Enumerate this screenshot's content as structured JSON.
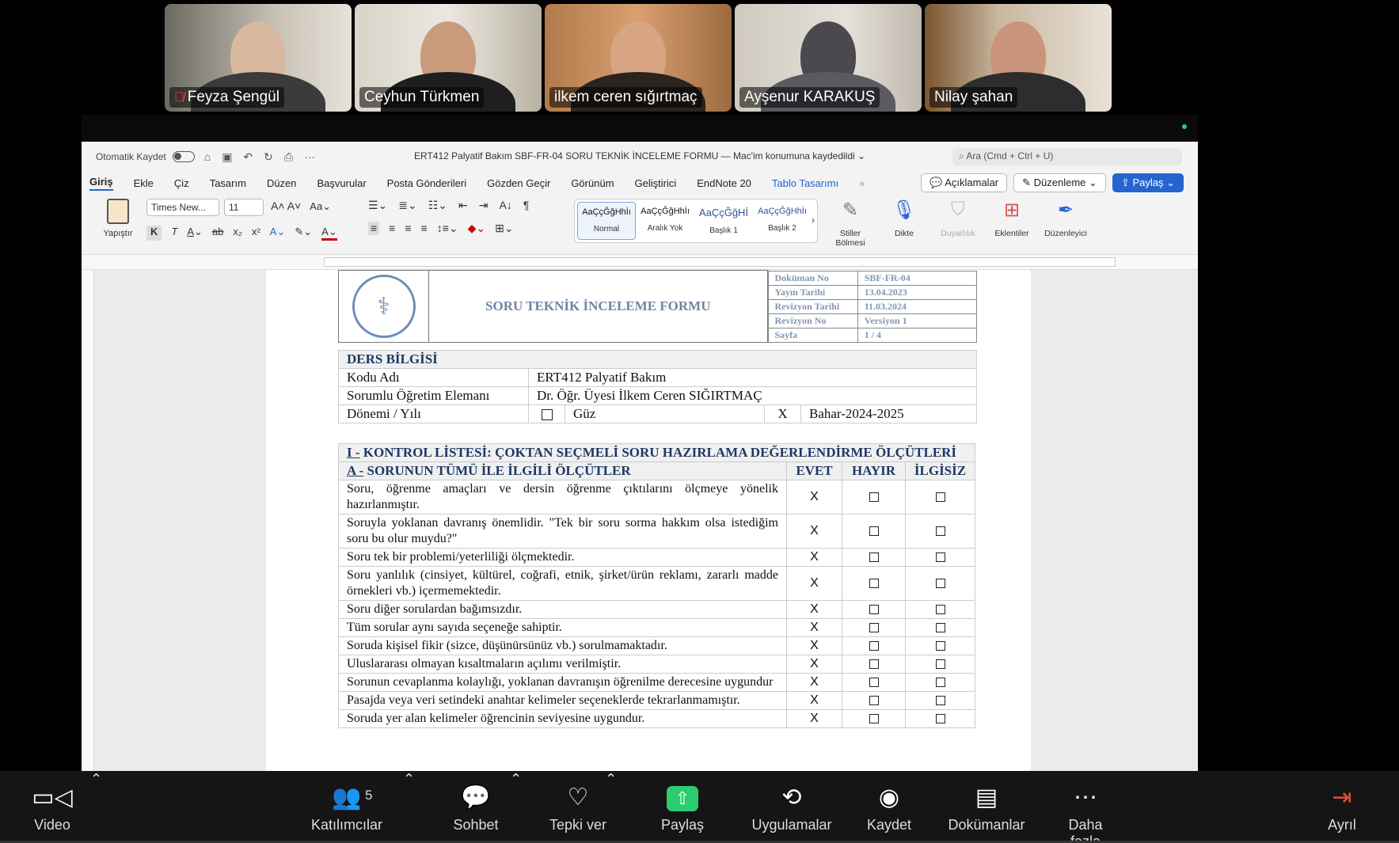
{
  "participants": [
    {
      "name": "Feyza Şengül",
      "muted": true,
      "color": "#7a6a5c"
    },
    {
      "name": "Ceyhun Türkmen",
      "muted": false,
      "active": true,
      "color": "#a7a08f"
    },
    {
      "name": "ilkem ceren sığırtmaç",
      "muted": false,
      "color": "#8a5a33"
    },
    {
      "name": "Ayşenur KARAKUŞ",
      "muted": false,
      "color": "#9a938c"
    },
    {
      "name": "Nilay şahan",
      "muted": false,
      "color": "#8e6b4a"
    }
  ],
  "word": {
    "autosave_label": "Otomatik Kaydet",
    "doc_title": "ERT412 Palyatif Bakım SBF-FR-04 SORU TEKNİK İNCELEME FORMU — Mac'im konumuna kaydedildi ⌄",
    "search_placeholder": "Ara (Cmd + Ctrl + U)",
    "tabs": [
      "Giriş",
      "Ekle",
      "Çiz",
      "Tasarım",
      "Düzen",
      "Başvurular",
      "Posta Gönderileri",
      "Gözden Geçir",
      "Görünüm",
      "Geliştirici",
      "EndNote 20",
      "Tablo Tasarımı"
    ],
    "comments_btn": "Açıklamalar",
    "editing_btn": "Düzenleme",
    "share_btn": "Paylaş",
    "paste_label": "Yapıştır",
    "font_name": "Times New...",
    "font_size": "11",
    "styles": [
      {
        "sample": "AaÇçĞğHhİı",
        "label": "Normal"
      },
      {
        "sample": "AaÇçĞğHhİı",
        "label": "Aralık Yok"
      },
      {
        "sample": "AaÇçĞğHİ",
        "label": "Başlık 1"
      },
      {
        "sample": "AaÇçĞğHhİı",
        "label": "Başlık 2"
      }
    ],
    "big_buttons": {
      "styles_pane": "Stiller Bölmesi",
      "dictate": "Dikte",
      "sensitivity": "Duyarlılık",
      "addins": "Eklentiler",
      "editor": "Düzenleyici"
    }
  },
  "form": {
    "title": "SORU TEKNİK İNCELEME FORMU",
    "meta": [
      {
        "label": "Doküman No",
        "value": "SBF-FR-04"
      },
      {
        "label": "Yayın Tarihi",
        "value": "13.04.2023"
      },
      {
        "label": "Revizyon Tarihi",
        "value": "11.03.2024"
      },
      {
        "label": "Revizyon No",
        "value": "Versiyon 1"
      },
      {
        "label": "Sayfa",
        "value": "1 / 4"
      }
    ],
    "course": {
      "heading": "DERS BİLGİSİ",
      "code_label": "Kodu Adı",
      "code_value": "ERT412 Palyatif Bakım",
      "instructor_label": "Sorumlu Öğretim Elemanı",
      "instructor_value": "Dr. Öğr. Üyesi İlkem Ceren SIĞIRTMAÇ",
      "term_label": "Dönemi / Yılı",
      "fall_label": "Güz",
      "spring_mark": "X",
      "spring_label": "Bahar-2024-2025"
    },
    "checklist": {
      "section_prefix": "I -",
      "section_title": "KONTROL LİSTESİ: ÇOKTAN SEÇMELİ SORU HAZIRLAMA DEĞERLENDİRME ÖLÇÜTLERİ",
      "sub_prefix": "A -",
      "sub_title": "SORUNUN TÜMÜ İLE İLGİLİ ÖLÇÜTLER",
      "col_yes": "EVET",
      "col_no": "HAYIR",
      "col_na": "İLGİSİZ",
      "mark": "X",
      "items": [
        "Soru, öğrenme amaçları ve dersin öğrenme çıktılarını ölçmeye yönelik hazırlanmıştır.",
        "Soruyla yoklanan davranış önemlidir. \"Tek bir soru sorma hakkım olsa istediğim soru bu olur muydu?\"",
        "Soru tek bir problemi/yeterliliği ölçmektedir.",
        "Soru yanlılık (cinsiyet, kültürel, coğrafi, etnik, şirket/ürün reklamı, zararlı madde örnekleri vb.) içermemektedir.",
        "Soru diğer sorulardan bağımsızdır.",
        "Tüm sorular aynı sayıda seçeneğe sahiptir.",
        "Soruda kişisel fikir (sizce, düşünürsünüz vb.) sorulmamaktadır.",
        "Uluslararası olmayan kısaltmaların açılımı verilmiştir.",
        "Sorunun cevaplanma kolaylığı, yoklanan davranışın öğrenilme derecesine uygundur",
        "Pasajda veya veri setindeki anahtar kelimeler seçeneklerde tekrarlanmamıştır.",
        "Soruda yer alan kelimeler öğrencinin seviyesine uygundur."
      ]
    }
  },
  "toolbar": {
    "video": "Video",
    "participants": "Katılımcılar",
    "participant_count": "5",
    "chat": "Sohbet",
    "react": "Tepki ver",
    "share": "Paylaş",
    "apps": "Uygulamalar",
    "record": "Kaydet",
    "docs": "Dokümanlar",
    "more": "Daha fazla",
    "leave": "Ayrıl"
  }
}
